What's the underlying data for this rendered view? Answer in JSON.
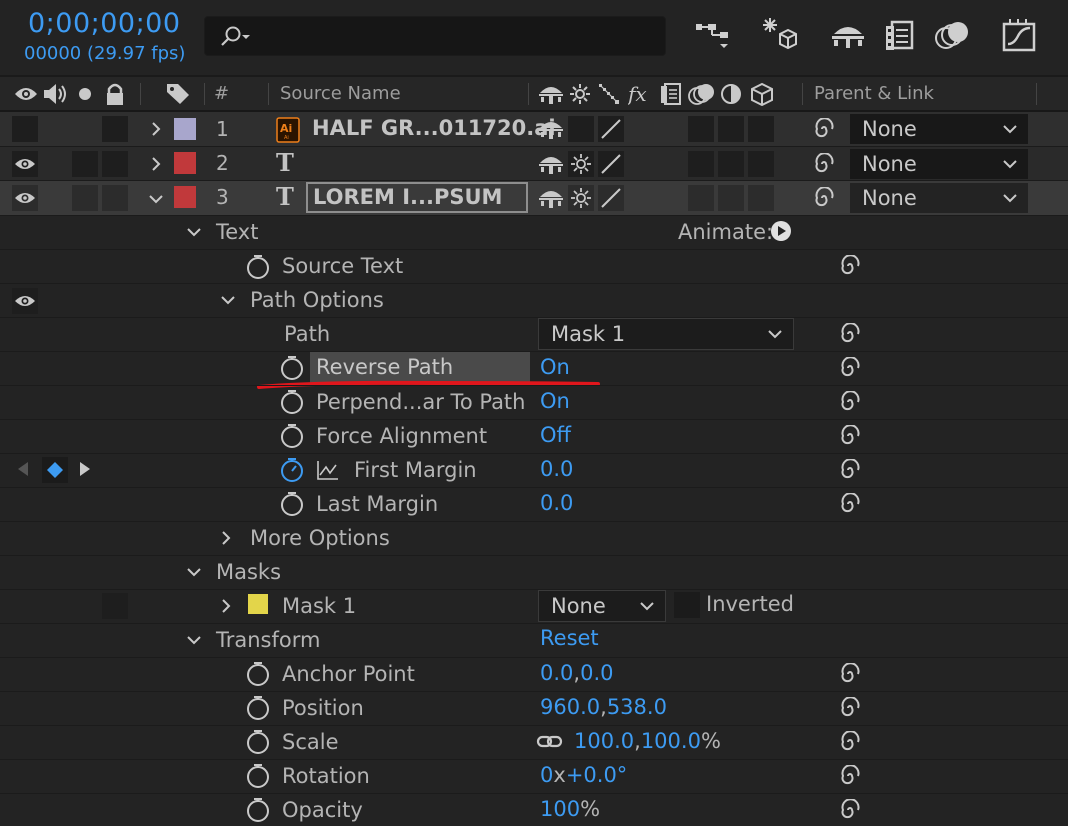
{
  "header": {
    "timecode": "0;00;00;00",
    "frame_info": "00000 (29.97 fps)",
    "search": {
      "value": "",
      "placeholder": ""
    }
  },
  "columns": {
    "number": "#",
    "source_name": "Source Name",
    "parent_link": "Parent & Link"
  },
  "layers": [
    {
      "index": "1",
      "name": "HALF GR...011720.ai",
      "type_icon": "illustrator-file-icon",
      "label_color": "#a8a6cc",
      "parent": "None",
      "expanded": false,
      "visible": false
    },
    {
      "index": "2",
      "name": "T",
      "type_icon": "text-layer-icon",
      "label_color": "#c1393b",
      "parent": "None",
      "expanded": false,
      "visible": true
    },
    {
      "index": "3",
      "name": "LOREM I...PSUM",
      "type_icon": "text-layer-icon",
      "label_color": "#c1393b",
      "parent": "None",
      "expanded": true,
      "visible": true
    }
  ],
  "layer2_label": "T",
  "layer3_label": "T",
  "properties": {
    "text": "Text",
    "animate": "Animate:",
    "source_text": "Source Text",
    "path_options": "Path Options",
    "path": {
      "label": "Path",
      "value": "Mask 1"
    },
    "reverse_path": {
      "label": "Reverse Path",
      "value": "On"
    },
    "perpendicular": {
      "label": "Perpend...ar To Path",
      "value": "On"
    },
    "force_alignment": {
      "label": "Force Alignment",
      "value": "Off"
    },
    "first_margin": {
      "label": "First Margin",
      "value": "0.0"
    },
    "last_margin": {
      "label": "Last Margin",
      "value": "0.0"
    },
    "more_options": "More Options",
    "masks": "Masks",
    "mask1": {
      "label": "Mask 1",
      "mode": "None",
      "inverted": "Inverted",
      "color": "#e3d54a"
    },
    "transform": {
      "label": "Transform",
      "reset": "Reset"
    },
    "anchor_point": {
      "label": "Anchor Point",
      "x": "0.0",
      "y": "0.0"
    },
    "position": {
      "label": "Position",
      "x": "960.0",
      "y": "538.0"
    },
    "scale": {
      "label": "Scale",
      "x": "100.0",
      "y": "100.0",
      "unit": "%"
    },
    "rotation": {
      "label": "Rotation",
      "turns": "0",
      "sep": "x",
      "degrees": "+0.0°"
    },
    "opacity": {
      "label": "Opacity",
      "value": "100",
      "unit": "%"
    }
  },
  "colors": {
    "accent": "#3d9bf2",
    "annotation": "#e0161c",
    "background": "#232323"
  }
}
